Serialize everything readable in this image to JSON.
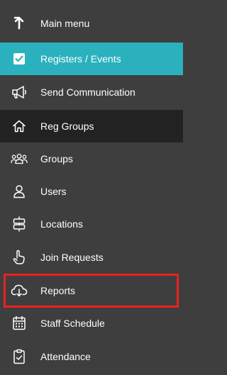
{
  "colors": {
    "background": "#3e3e3e",
    "active": "#2ab1bd",
    "current": "#222222",
    "highlight": "#e8231f",
    "text": "#ffffff"
  },
  "menu": {
    "items": [
      {
        "label": "Main menu",
        "icon": "arrow-up-icon"
      },
      {
        "label": "Registers / Events",
        "icon": "checkbox-icon",
        "state": "active"
      },
      {
        "label": "Send Communication",
        "icon": "megaphone-icon"
      },
      {
        "label": "Reg Groups",
        "icon": "home-icon",
        "state": "current"
      },
      {
        "label": "Groups",
        "icon": "people-group-icon"
      },
      {
        "label": "Users",
        "icon": "user-icon"
      },
      {
        "label": "Locations",
        "icon": "signpost-icon"
      },
      {
        "label": "Join Requests",
        "icon": "hand-pointer-icon"
      },
      {
        "label": "Reports",
        "icon": "cloud-download-icon",
        "highlighted": true
      },
      {
        "label": "Staff Schedule",
        "icon": "calendar-icon"
      },
      {
        "label": "Attendance",
        "icon": "clipboard-check-icon"
      }
    ]
  }
}
